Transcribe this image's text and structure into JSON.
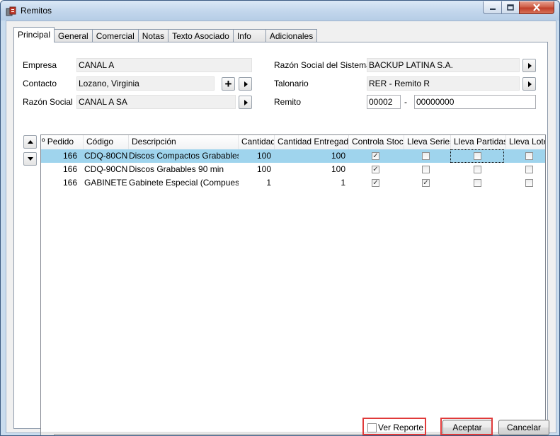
{
  "window": {
    "title": "Remitos"
  },
  "tabs": [
    "Principal",
    "General",
    "Comercial",
    "Notas",
    "Texto Asociado",
    "Info",
    "Adicionales"
  ],
  "form": {
    "empresa_label": "Empresa",
    "empresa_value": "CANAL A",
    "contacto_label": "Contacto",
    "contacto_value": "Lozano, Virginia",
    "razon_social_label": "Razón Social",
    "razon_social_value": "CANAL A SA",
    "razon_sistema_label": "Razón Social del Sistema",
    "razon_sistema_value": "BACKUP LATINA S.A.",
    "talonario_label": "Talonario",
    "talonario_value": "RER - Remito R",
    "remito_label": "Remito",
    "remito_prefix": "00002",
    "remito_sep": "-",
    "remito_number": "00000000"
  },
  "grid": {
    "columns": [
      "º Pedido",
      "Código",
      "Descripción",
      "Cantidad",
      "Cantidad Entregada",
      "Controla Stock",
      "Lleva Series",
      "Lleva Partidas",
      "Lleva Lote"
    ],
    "rows": [
      {
        "pedido": "166",
        "codigo": "CDQ-80CN",
        "descripcion": "Discos Compactos Grabables",
        "cantidad": "100",
        "entregada": "100",
        "controla_stock": true,
        "lleva_series": false,
        "lleva_partidas": false,
        "lleva_lote": false
      },
      {
        "pedido": "166",
        "codigo": "CDQ-90CN",
        "descripcion": "Discos Grabables 90 min",
        "cantidad": "100",
        "entregada": "100",
        "controla_stock": true,
        "lleva_series": false,
        "lleva_partidas": false,
        "lleva_lote": false
      },
      {
        "pedido": "166",
        "codigo": "GABINETE E",
        "descripcion": "Gabinete Especial (Compuesto)",
        "cantidad": "1",
        "entregada": "1",
        "controla_stock": true,
        "lleva_series": true,
        "lleva_partidas": false,
        "lleva_lote": false
      }
    ],
    "selected_row": 0
  },
  "footer": {
    "ver_reporte": "Ver Reporte",
    "ver_reporte_checked": false,
    "aceptar": "Aceptar",
    "cancelar": "Cancelar"
  },
  "icons": [
    "app-icon",
    "minimize-icon",
    "maximize-icon",
    "close-icon",
    "play-arrow-icon",
    "plus-icon",
    "move-up-icon",
    "move-down-icon"
  ],
  "colors": {
    "selection": "#9fd4ed",
    "highlight_box": "#e03a3a",
    "titlebar": "#c2d6ec"
  }
}
